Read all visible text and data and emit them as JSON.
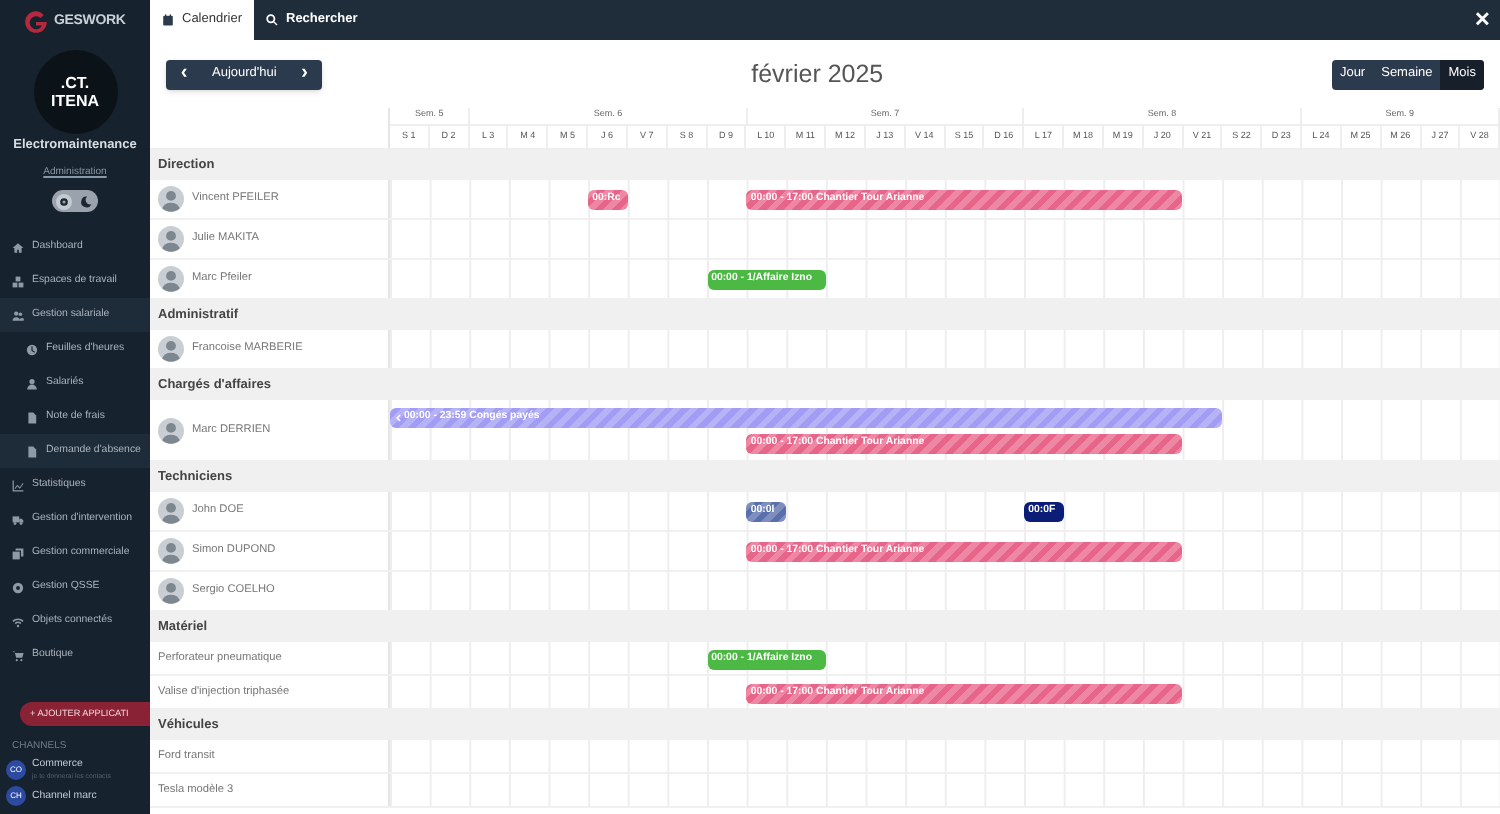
{
  "sidebar": {
    "brand": "GESWORK",
    "company_logo": [
      ".CT.",
      "ITENA"
    ],
    "company": "Electromaintenance",
    "role_link": "Administration",
    "dark_mode": false,
    "nav": [
      {
        "label": "Dashboard",
        "selected": false
      },
      {
        "label": "Espaces de travail",
        "selected": false
      },
      {
        "label": "Gestion salariale",
        "selected": true,
        "children": [
          {
            "label": "Feuilles d'heures",
            "selected": false
          },
          {
            "label": "Salariés",
            "selected": false
          },
          {
            "label": "Note de frais",
            "selected": false
          },
          {
            "label": "Demande d'absence",
            "selected": true
          }
        ]
      },
      {
        "label": "Statistiques",
        "selected": false
      },
      {
        "label": "Gestion d'intervention",
        "selected": false
      },
      {
        "label": "Gestion commerciale",
        "selected": false
      },
      {
        "label": "Gestion QSSE",
        "selected": false
      },
      {
        "label": "Objets connectés",
        "selected": false
      },
      {
        "label": "Boutique",
        "selected": false
      }
    ],
    "add_button": "+ AJOUTER APPLICATI",
    "channels_title": "CHANNELS",
    "channels": [
      {
        "initials": "CO",
        "name": "Commerce",
        "preview": "je te donnerai les contacts"
      },
      {
        "initials": "CH",
        "name": "Channel marc"
      }
    ]
  },
  "tabs": [
    {
      "label": "Calendrier",
      "selected": true
    },
    {
      "label": "Rechercher",
      "selected": false
    }
  ],
  "close": "✕",
  "toolbar": {
    "prev": "‹",
    "today": "Aujourd'hui",
    "next": "›",
    "title": "février 2025",
    "views": [
      {
        "label": "Jour",
        "selected": false
      },
      {
        "label": "Semaine",
        "selected": false
      },
      {
        "label": "Mois",
        "selected": true
      }
    ]
  },
  "weeks": [
    {
      "label": "Sem. 5",
      "days": [
        "S 1",
        "D 2"
      ]
    },
    {
      "label": "Sem. 6",
      "days": [
        "L 3",
        "M 4",
        "M 5",
        "J 6",
        "V 7",
        "S 8",
        "D 9"
      ]
    },
    {
      "label": "Sem. 7",
      "days": [
        "L 10",
        "M 11",
        "M 12",
        "J 13",
        "V 14",
        "S 15",
        "D 16"
      ]
    },
    {
      "label": "Sem. 8",
      "days": [
        "L 17",
        "M 18",
        "M 19",
        "J 20",
        "V 21",
        "S 22",
        "D 23"
      ]
    },
    {
      "label": "Sem. 9",
      "days": [
        "L 24",
        "M 25",
        "M 26",
        "J 27",
        "V 28"
      ]
    }
  ],
  "groups": [
    {
      "label": "Direction",
      "rows": [
        {
          "name": "Vincent PFEILER",
          "avatar": true,
          "lanes": [
            [
              {
                "kind": "empty"
              },
              {
                "kind": "empty"
              },
              {
                "kind": "empty"
              },
              {
                "kind": "empty"
              },
              {
                "kind": "empty"
              },
              {
                "kind": "event",
                "label": "00:Rc",
                "color": "#e8658a",
                "striped": true
              },
              {
                "kind": "empty"
              },
              {
                "kind": "empty"
              },
              {
                "kind": "empty"
              },
              {
                "kind": "event",
                "label": "00:00 - 17:00 Chantier Tour Arianne",
                "color": "#e8658a",
                "striped": true
              },
              {
                "kind": "continued"
              },
              {
                "kind": "continued"
              },
              {
                "kind": "continued"
              },
              {
                "kind": "continued"
              },
              {
                "kind": "continued"
              },
              {
                "kind": "continued"
              },
              {
                "kind": "continued"
              },
              {
                "kind": "continued"
              },
              {
                "kind": "continued"
              },
              {
                "kind": "continued"
              }
            ]
          ]
        },
        {
          "name": "Julie MAKITA",
          "avatar": true
        },
        {
          "name": "Marc Pfeiler",
          "avatar": true,
          "lanes": [
            [
              {
                "kind": "empty"
              },
              {
                "kind": "empty"
              },
              {
                "kind": "empty"
              },
              {
                "kind": "empty"
              },
              {
                "kind": "empty"
              },
              {
                "kind": "empty"
              },
              {
                "kind": "empty"
              },
              {
                "kind": "empty"
              },
              {
                "kind": "event",
                "label": "00:00 - 1/Affaire Izno",
                "color": "#4cb944",
                "striped": false
              },
              {
                "kind": "continued"
              },
              {
                "kind": "continued"
              }
            ]
          ]
        }
      ]
    },
    {
      "label": "Administratif",
      "rows": [
        {
          "name": "Francoise MARBERIE",
          "avatar": true
        }
      ]
    },
    {
      "label": "Chargés d'affaires",
      "rows": [
        {
          "name": "Marc DERRIEN",
          "avatar": true,
          "lanes": [
            [
              {
                "kind": "event",
                "label": "00:00 - 23:59 Congés payés",
                "color": "#a29cf4",
                "striped": true,
                "continues_before": true
              },
              {
                "kind": "continued"
              },
              {
                "kind": "continued"
              },
              {
                "kind": "continued"
              },
              {
                "kind": "continued"
              },
              {
                "kind": "continued"
              },
              {
                "kind": "continued"
              },
              {
                "kind": "continued"
              },
              {
                "kind": "continued"
              },
              {
                "kind": "continued"
              },
              {
                "kind": "continued"
              },
              {
                "kind": "continued"
              },
              {
                "kind": "continued"
              },
              {
                "kind": "continued"
              },
              {
                "kind": "continued"
              },
              {
                "kind": "continued"
              },
              {
                "kind": "continued"
              },
              {
                "kind": "continued"
              },
              {
                "kind": "continued"
              },
              {
                "kind": "continued"
              },
              {
                "kind": "continued"
              }
            ],
            [
              {
                "kind": "empty"
              },
              {
                "kind": "empty"
              },
              {
                "kind": "empty"
              },
              {
                "kind": "empty"
              },
              {
                "kind": "empty"
              },
              {
                "kind": "empty"
              },
              {
                "kind": "empty"
              },
              {
                "kind": "empty"
              },
              {
                "kind": "empty"
              },
              {
                "kind": "event",
                "label": "00:00 - 17:00 Chantier Tour Arianne",
                "color": "#e8658a",
                "striped": true
              },
              {
                "kind": "continued"
              },
              {
                "kind": "continued"
              },
              {
                "kind": "continued"
              },
              {
                "kind": "continued"
              },
              {
                "kind": "continued"
              },
              {
                "kind": "continued"
              },
              {
                "kind": "continued"
              },
              {
                "kind": "continued"
              },
              {
                "kind": "continued"
              },
              {
                "kind": "continued"
              }
            ]
          ]
        }
      ]
    },
    {
      "label": "Techniciens",
      "rows": [
        {
          "name": "John DOE",
          "avatar": true,
          "lanes": [
            [
              {
                "kind": "empty"
              },
              {
                "kind": "empty"
              },
              {
                "kind": "empty"
              },
              {
                "kind": "empty"
              },
              {
                "kind": "empty"
              },
              {
                "kind": "empty"
              },
              {
                "kind": "empty"
              },
              {
                "kind": "empty"
              },
              {
                "kind": "empty"
              },
              {
                "kind": "event",
                "label": "00:0I",
                "color": "#5a70ad",
                "striped": true
              },
              {
                "kind": "empty"
              },
              {
                "kind": "empty"
              },
              {
                "kind": "empty"
              },
              {
                "kind": "empty"
              },
              {
                "kind": "empty"
              },
              {
                "kind": "empty"
              },
              {
                "kind": "event",
                "label": "00:0F",
                "color": "#0c1d78",
                "striped": false
              }
            ]
          ]
        },
        {
          "name": "Simon DUPOND",
          "avatar": true,
          "lanes": [
            [
              {
                "kind": "empty"
              },
              {
                "kind": "empty"
              },
              {
                "kind": "empty"
              },
              {
                "kind": "empty"
              },
              {
                "kind": "empty"
              },
              {
                "kind": "empty"
              },
              {
                "kind": "empty"
              },
              {
                "kind": "empty"
              },
              {
                "kind": "empty"
              },
              {
                "kind": "event",
                "label": "00:00 - 17:00 Chantier Tour Arianne",
                "color": "#e8658a",
                "striped": true
              },
              {
                "kind": "continued"
              },
              {
                "kind": "continued"
              },
              {
                "kind": "continued"
              },
              {
                "kind": "continued"
              },
              {
                "kind": "continued"
              },
              {
                "kind": "continued"
              },
              {
                "kind": "continued"
              },
              {
                "kind": "continued"
              },
              {
                "kind": "continued"
              },
              {
                "kind": "continued"
              }
            ]
          ]
        },
        {
          "name": "Sergio COELHO",
          "avatar": true
        }
      ]
    },
    {
      "label": "Matériel",
      "rows": [
        {
          "name": "Perforateur pneumatique",
          "avatar": false,
          "lanes": [
            [
              {
                "kind": "empty"
              },
              {
                "kind": "empty"
              },
              {
                "kind": "empty"
              },
              {
                "kind": "empty"
              },
              {
                "kind": "empty"
              },
              {
                "kind": "empty"
              },
              {
                "kind": "empty"
              },
              {
                "kind": "empty"
              },
              {
                "kind": "event",
                "label": "00:00 - 1/Affaire Izno",
                "color": "#4cb944",
                "striped": false
              },
              {
                "kind": "continued"
              },
              {
                "kind": "continued"
              }
            ]
          ]
        },
        {
          "name": "Valise d'injection triphasée",
          "avatar": false,
          "lanes": [
            [
              {
                "kind": "empty"
              },
              {
                "kind": "empty"
              },
              {
                "kind": "empty"
              },
              {
                "kind": "empty"
              },
              {
                "kind": "empty"
              },
              {
                "kind": "empty"
              },
              {
                "kind": "empty"
              },
              {
                "kind": "empty"
              },
              {
                "kind": "empty"
              },
              {
                "kind": "event",
                "label": "00:00 - 17:00 Chantier Tour Arianne",
                "color": "#e8658a",
                "striped": true
              },
              {
                "kind": "continued"
              },
              {
                "kind": "continued"
              },
              {
                "kind": "continued"
              },
              {
                "kind": "continued"
              },
              {
                "kind": "continued"
              },
              {
                "kind": "continued"
              },
              {
                "kind": "continued"
              },
              {
                "kind": "continued"
              },
              {
                "kind": "continued"
              },
              {
                "kind": "continued"
              }
            ]
          ]
        }
      ]
    },
    {
      "label": "Véhicules",
      "rows": [
        {
          "name": "Ford transit",
          "avatar": false
        },
        {
          "name": "Tesla modèle 3",
          "avatar": false
        }
      ]
    }
  ]
}
